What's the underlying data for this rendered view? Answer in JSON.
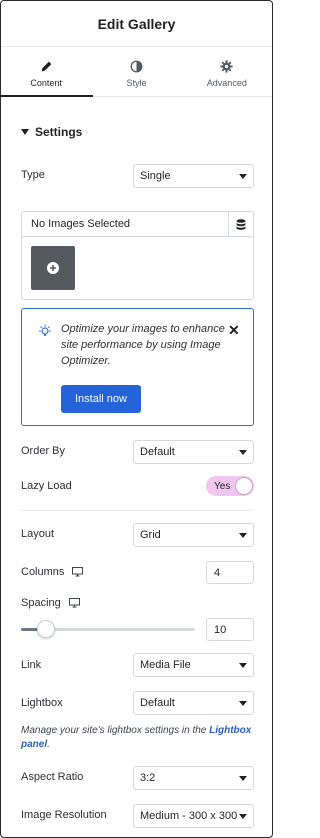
{
  "header": {
    "title": "Edit Gallery"
  },
  "tabs": [
    {
      "label": "Content",
      "icon": "pencil-icon",
      "active": true
    },
    {
      "label": "Style",
      "icon": "half-circle-icon",
      "active": false
    },
    {
      "label": "Advanced",
      "icon": "gear-icon",
      "active": false
    }
  ],
  "section": {
    "title": "Settings"
  },
  "type": {
    "label": "Type",
    "value": "Single"
  },
  "gallery": {
    "empty_text": "No Images Selected"
  },
  "notice": {
    "text": "Optimize your images to enhance site performance by using Image Optimizer.",
    "close": "✕",
    "button": "Install now"
  },
  "order_by": {
    "label": "Order By",
    "value": "Default"
  },
  "lazy_load": {
    "label": "Lazy Load",
    "toggle_label": "Yes",
    "on": true
  },
  "layout": {
    "label": "Layout",
    "value": "Grid"
  },
  "columns": {
    "label": "Columns",
    "value": "4"
  },
  "spacing": {
    "label": "Spacing",
    "value": "10",
    "slider_fraction": 0.1
  },
  "link": {
    "label": "Link",
    "value": "Media File"
  },
  "lightbox": {
    "label": "Lightbox",
    "value": "Default"
  },
  "help": {
    "prefix": "Manage your site's lightbox settings in the ",
    "link": "Lightbox panel",
    "suffix": "."
  },
  "aspect_ratio": {
    "label": "Aspect Ratio",
    "value": "3:2"
  },
  "image_resolution": {
    "label": "Image Resolution",
    "value": "Medium - 300 x 300"
  },
  "colors": {
    "accent": "#2563d9",
    "toggle": "#f1c6f0",
    "border": "#d5d8dc"
  }
}
